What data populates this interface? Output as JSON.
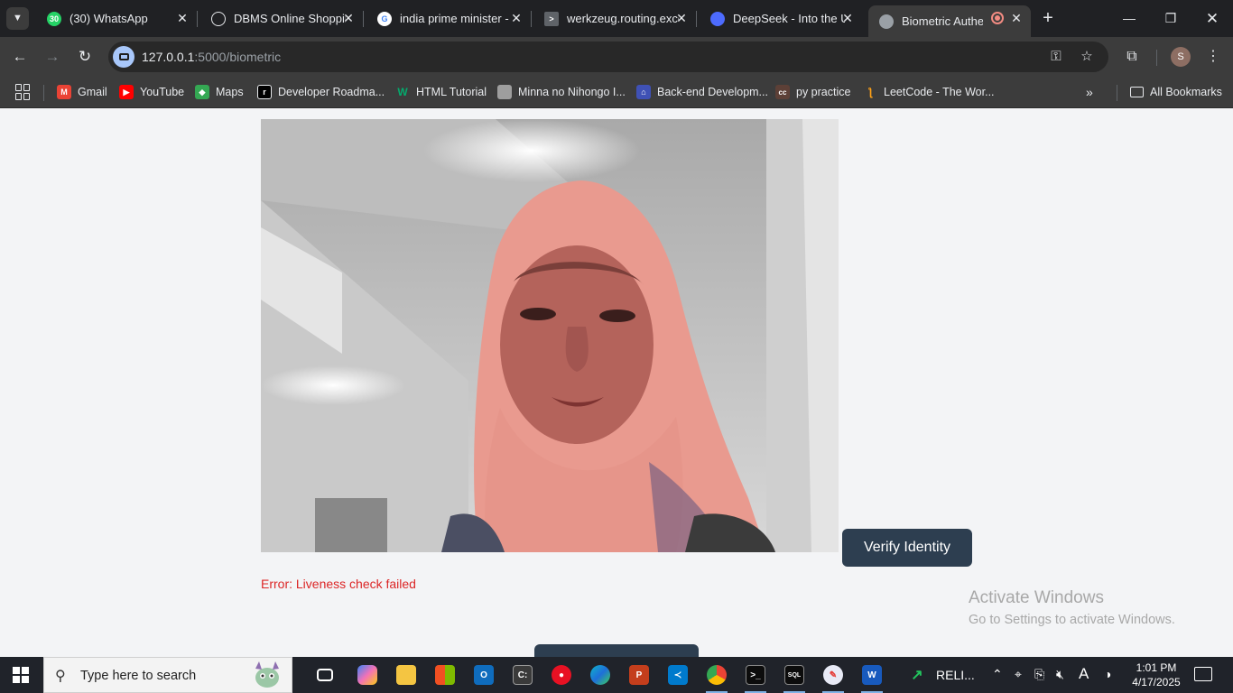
{
  "browser": {
    "tabs": [
      {
        "title": "(30) WhatsApp",
        "favicon": "whatsapp-icon",
        "color": "#25d366",
        "badge": "30"
      },
      {
        "title": "DBMS Online Shopping",
        "favicon": "openai-icon",
        "color": "#ffffff"
      },
      {
        "title": "india prime minister - Google Search",
        "favicon": "google-icon",
        "color": "#ffffff"
      },
      {
        "title": "werkzeug.routing.exceptions",
        "favicon": "terminal-icon",
        "color": "#8ab4f8"
      },
      {
        "title": "DeepSeek - Into the Unknown",
        "favicon": "deepseek-icon",
        "color": "#4d6bfe"
      },
      {
        "title": "Biometric Authentication",
        "favicon": "globe-icon",
        "color": "#9aa0a6",
        "active": true,
        "recording": true
      }
    ],
    "url_host": "127.0.0.1",
    "url_path": ":5000/biometric",
    "bookmarks": [
      {
        "label": "Gmail",
        "icon": "gmail-icon",
        "color": "#ea4335"
      },
      {
        "label": "YouTube",
        "icon": "youtube-icon",
        "color": "#ff0000"
      },
      {
        "label": "Maps",
        "icon": "maps-icon",
        "color": "#34a853"
      },
      {
        "label": "Developer Roadma...",
        "icon": "roadmap-icon",
        "color": "#000000"
      },
      {
        "label": "HTML Tutorial",
        "icon": "w3schools-icon",
        "color": "#04aa6d"
      },
      {
        "label": "Minna no Nihongo I...",
        "icon": "book-icon",
        "color": "#9e9e9e"
      },
      {
        "label": "Back-end Developm...",
        "icon": "freecodecamp-icon",
        "color": "#3f51b5"
      },
      {
        "label": "py practice",
        "icon": "cc-icon",
        "color": "#5d4037"
      },
      {
        "label": "LeetCode - The Wor...",
        "icon": "leetcode-icon",
        "color": "#ffa116"
      }
    ],
    "all_bookmarks": "All Bookmarks",
    "profile_initial": "S"
  },
  "page": {
    "verify_button": "Verify Identity",
    "error": "Error: Liveness check failed"
  },
  "watermark": {
    "line1": "Activate Windows",
    "line2": "Go to Settings to activate Windows."
  },
  "taskbar": {
    "search_placeholder": "Type here to search",
    "tray_app_label": "RELI...",
    "time": "1:01 PM",
    "date": "4/17/2025"
  }
}
